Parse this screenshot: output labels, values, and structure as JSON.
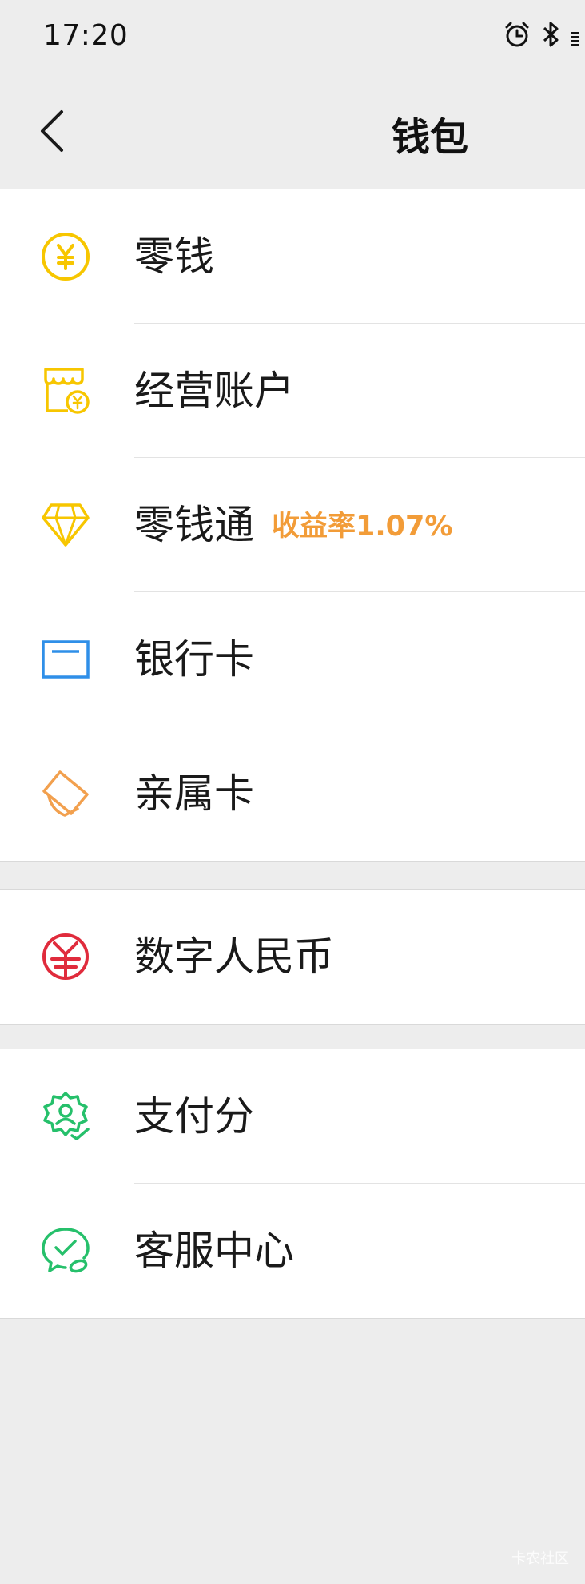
{
  "status_bar": {
    "time": "17:20",
    "icons": [
      "alarm-icon",
      "bluetooth-icon",
      "signal-icon"
    ]
  },
  "nav": {
    "title": "钱包",
    "back_icon": "chevron-left-icon"
  },
  "groups": [
    {
      "items": [
        {
          "label": "零钱",
          "icon": "yuan-coin-icon",
          "color": "#f7c600"
        },
        {
          "label": "经营账户",
          "icon": "shop-account-icon",
          "color": "#f7c600"
        },
        {
          "label": "零钱通",
          "sub": "收益率1.07%",
          "icon": "diamond-icon",
          "color": "#f7c600"
        },
        {
          "label": "银行卡",
          "icon": "bank-card-icon",
          "color": "#2f8fe8"
        },
        {
          "label": "亲属卡",
          "icon": "family-card-icon",
          "color": "#f2a04e"
        }
      ]
    },
    {
      "items": [
        {
          "label": "数字人民币",
          "icon": "digital-rmb-icon",
          "color": "#e02b3c"
        }
      ]
    },
    {
      "items": [
        {
          "label": "支付分",
          "icon": "pay-score-icon",
          "color": "#26c06b"
        },
        {
          "label": "客服中心",
          "icon": "customer-service-icon",
          "color": "#26c06b"
        }
      ]
    }
  ],
  "watermark": "卡农社区"
}
